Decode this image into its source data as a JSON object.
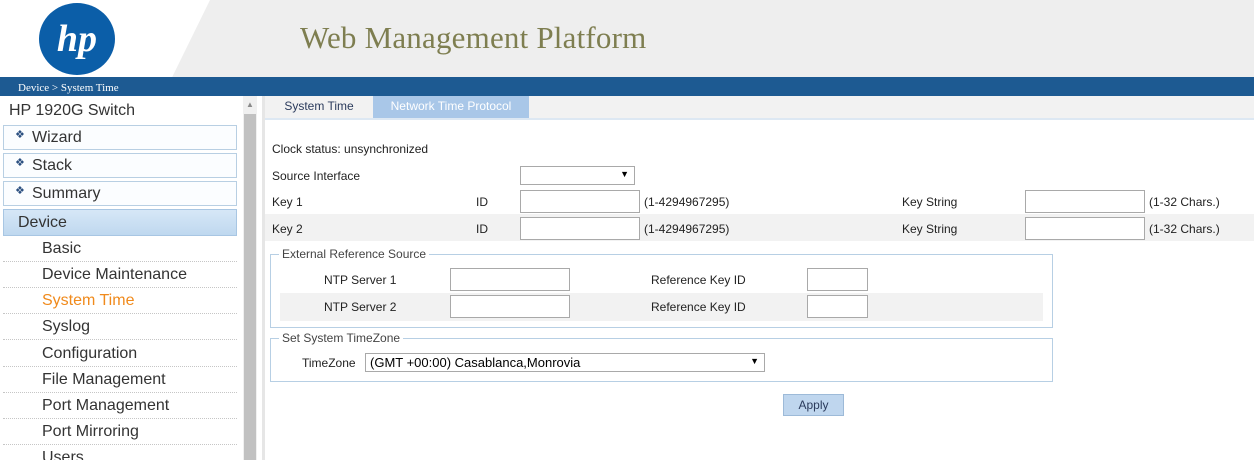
{
  "header": {
    "logo_text": "hp",
    "title": "Web Management Platform"
  },
  "breadcrumb": "Device > System Time",
  "sidebar": {
    "device_name": "HP 1920G Switch",
    "menu": [
      {
        "label": "Wizard"
      },
      {
        "label": "Stack"
      },
      {
        "label": "Summary"
      }
    ],
    "active_menu": "Device",
    "subitems": [
      {
        "label": "Basic"
      },
      {
        "label": "Device Maintenance"
      },
      {
        "label": "System Time"
      },
      {
        "label": "Syslog"
      },
      {
        "label": "Configuration"
      },
      {
        "label": "File Management"
      },
      {
        "label": "Port Management"
      },
      {
        "label": "Port Mirroring"
      },
      {
        "label": "Users"
      }
    ],
    "active_subitem": "System Time"
  },
  "tabs": [
    {
      "label": "System Time"
    },
    {
      "label": "Network Time Protocol"
    }
  ],
  "form": {
    "clock_status": "Clock status: unsynchronized",
    "source_interface_label": "Source Interface",
    "source_interface_value": "",
    "keys": [
      {
        "label": "Key 1",
        "id_label": "ID",
        "id_value": "",
        "id_range": "(1-4294967295)",
        "string_label": "Key String",
        "string_value": "",
        "string_range": "(1-32 Chars.)"
      },
      {
        "label": "Key 2",
        "id_label": "ID",
        "id_value": "",
        "id_range": "(1-4294967295)",
        "string_label": "Key String",
        "string_value": "",
        "string_range": "(1-32 Chars.)"
      }
    ],
    "external": {
      "legend": "External Reference Source",
      "servers": [
        {
          "label": "NTP Server 1",
          "value": "",
          "ref_label": "Reference Key ID",
          "ref_value": ""
        },
        {
          "label": "NTP Server 2",
          "value": "",
          "ref_label": "Reference Key ID",
          "ref_value": ""
        }
      ]
    },
    "timezone": {
      "legend": "Set System TimeZone",
      "label": "TimeZone",
      "value": "(GMT +00:00) Casablanca,Monrovia"
    },
    "apply_label": "Apply"
  },
  "colors": {
    "brand_blue": "#1d5a92",
    "title_olive": "#7e7e50",
    "active_orange": "#f08a1c",
    "tab_active": "#a9c7e8"
  }
}
